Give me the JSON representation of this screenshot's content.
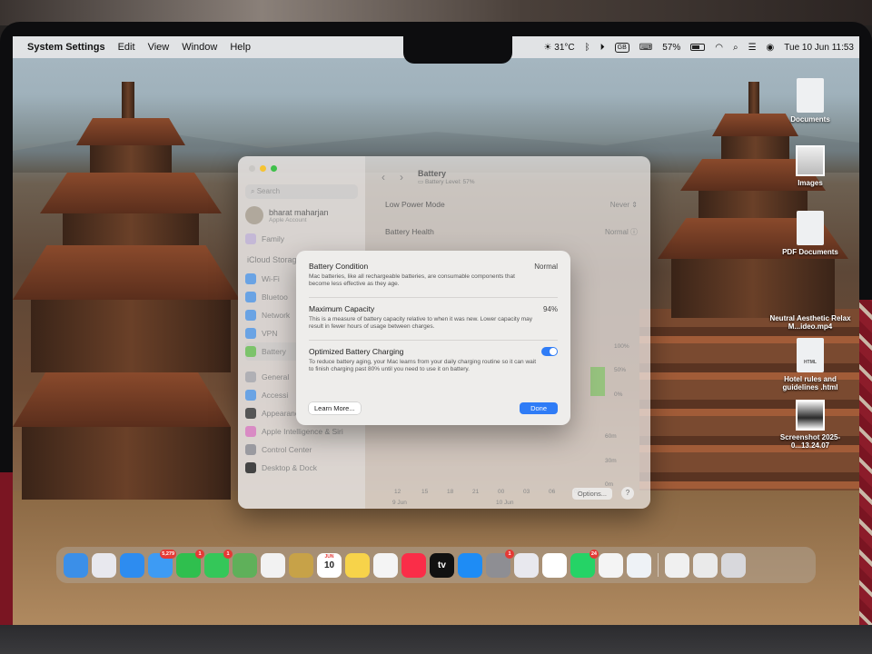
{
  "menubar": {
    "apple": "",
    "app_name": "System Settings",
    "items": [
      "Edit",
      "View",
      "Window",
      "Help"
    ],
    "status": {
      "weather": "31°C",
      "keyboard_input": "GB",
      "battery_percent": "57%",
      "battery_level": 0.57,
      "datetime": "Tue 10 Jun  11:53"
    }
  },
  "desktop_icons": [
    {
      "label": "Documents",
      "kind": "folder"
    },
    {
      "label": "Images",
      "kind": "photo"
    },
    {
      "label": "PDF Documents",
      "kind": "folder"
    },
    {
      "label": "Neutral Aesthetic Relax M...ideo.mp4",
      "kind": "video"
    },
    {
      "label": "Hotel rules and guidelines .html",
      "kind": "html",
      "badge": "HTML"
    },
    {
      "label": "Screenshot 2025-0...13.24.07",
      "kind": "photo"
    }
  ],
  "settings": {
    "search_placeholder": "Search",
    "account_name": "bharat maharjan",
    "account_sub": "Apple Account",
    "family": "Family",
    "icloud_group": "iCloud Storag",
    "sidebar_items": [
      "Wi-Fi",
      "Bluetoo",
      "Network",
      "VPN",
      "Battery",
      "General",
      "Accessi",
      "Appearance",
      "Apple Intelligence & Siri",
      "Control Center",
      "Desktop & Dock"
    ],
    "page_title": "Battery",
    "battery_level_text": "Battery Level: 57%",
    "low_power_label": "Low Power Mode",
    "low_power_value": "Never",
    "health_label": "Battery Health",
    "health_value": "Normal",
    "chart_pct_ticks": [
      "100%",
      "50%",
      "0%"
    ],
    "chart_min_ticks": [
      "60m",
      "30m",
      "0m"
    ],
    "chart_x_ticks": [
      "12",
      "15",
      "18",
      "21",
      "00",
      "03",
      "06",
      "09"
    ],
    "chart_day_labels": [
      "9 Jun",
      "10 Jun"
    ],
    "options_label": "Options...",
    "help_label": "?"
  },
  "sheet": {
    "condition_title": "Battery Condition",
    "condition_value": "Normal",
    "condition_desc": "Mac batteries, like all rechargeable batteries, are consumable components that become less effective as they age.",
    "capacity_title": "Maximum Capacity",
    "capacity_value": "94%",
    "capacity_desc": "This is a measure of battery capacity relative to when it was new. Lower capacity may result in fewer hours of usage between charges.",
    "optimized_title": "Optimized Battery Charging",
    "optimized_enabled": true,
    "optimized_desc": "To reduce battery aging, your Mac learns from your daily charging routine so it can wait to finish charging past 80% until you need to use it on battery.",
    "learn_more": "Learn More...",
    "done": "Done"
  },
  "dock": {
    "apps": [
      {
        "name": "Finder",
        "color": "#3b8fe8",
        "badge": ""
      },
      {
        "name": "Launchpad",
        "color": "#e8e8ee",
        "badge": ""
      },
      {
        "name": "Safari",
        "color": "#2d8cf0",
        "badge": ""
      },
      {
        "name": "Mail",
        "color": "#3d9bf4",
        "badge": "5,279"
      },
      {
        "name": "FaceTime",
        "color": "#2fbf4e",
        "badge": "1"
      },
      {
        "name": "Messages",
        "color": "#34c759",
        "badge": "1"
      },
      {
        "name": "Maps",
        "color": "#5fb05a",
        "badge": ""
      },
      {
        "name": "Photos",
        "color": "#f2f2f2",
        "badge": ""
      },
      {
        "name": "Notes Archive",
        "color": "#c7a248",
        "badge": ""
      },
      {
        "name": "Calendar",
        "color": "#ffffff",
        "badge": "",
        "text": "10",
        "month": "JUN"
      },
      {
        "name": "Notes",
        "color": "#f7d34a",
        "badge": ""
      },
      {
        "name": "Freeform",
        "color": "#f4f4f4",
        "badge": ""
      },
      {
        "name": "Music",
        "color": "#fa2d48",
        "badge": ""
      },
      {
        "name": "TV",
        "color": "#111111",
        "badge": "",
        "text": "tv"
      },
      {
        "name": "App Store",
        "color": "#1e8cf5",
        "badge": ""
      },
      {
        "name": "System Settings",
        "color": "#8e8e93",
        "badge": "1"
      },
      {
        "name": "iPhone Mirroring",
        "color": "#e8e8ee",
        "badge": ""
      },
      {
        "name": "Screen Recorder",
        "color": "#ffffff",
        "badge": ""
      },
      {
        "name": "WhatsApp",
        "color": "#25d366",
        "badge": "24"
      },
      {
        "name": "VLC",
        "color": "#f4f4f4",
        "badge": ""
      },
      {
        "name": "Preview",
        "color": "#eef2f6",
        "badge": ""
      }
    ],
    "right_items": [
      {
        "name": "Document Stack",
        "color": "#f0f0f0"
      },
      {
        "name": "Downloads Stack",
        "color": "#eaeaea"
      },
      {
        "name": "Trash",
        "color": "#d8d8dc"
      }
    ]
  }
}
